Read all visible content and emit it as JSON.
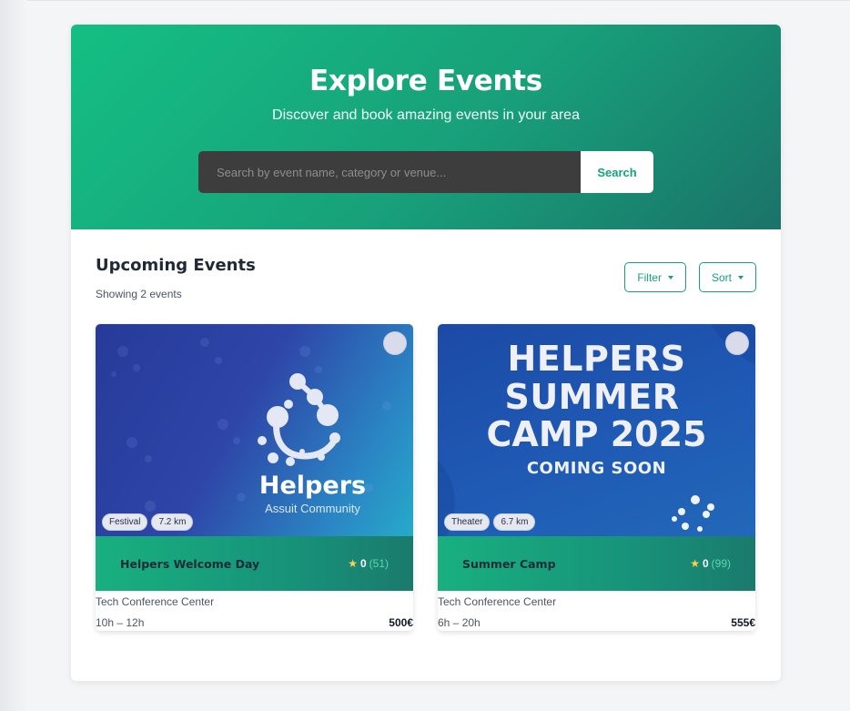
{
  "hero": {
    "title": "Explore Events",
    "subtitle": "Discover and book amazing events in your area",
    "search_placeholder": "Search by event name, category or venue...",
    "search_button": "Search"
  },
  "events_section": {
    "title": "Upcoming Events",
    "count_text": "Showing 2 events",
    "filter_label": "Filter",
    "sort_label": "Sort"
  },
  "events": [
    {
      "title": "Helpers Welcome Day",
      "category": "Festival",
      "distance": "7.2 km",
      "rating": "0",
      "reviews": "(51)",
      "venue": "Tech Conference Center",
      "time": "10h – 12h",
      "price": "500€",
      "image_text": {
        "brand": "Helpers",
        "tagline": "Assuit Community"
      }
    },
    {
      "title": "Summer Camp",
      "category": "Theater",
      "distance": "6.7 km",
      "rating": "0",
      "reviews": "(99)",
      "venue": "Tech Conference Center",
      "time": "6h – 20h",
      "price": "555€",
      "image_text": {
        "line1": "HELPERS",
        "line2": "SUMMER",
        "line3": "CAMP 2025",
        "line4": "COMING SOON"
      }
    }
  ],
  "colors": {
    "accent": "#18a07a",
    "hero_start": "#14bf83",
    "hero_end": "#1a7369",
    "star": "#fcd34d"
  }
}
